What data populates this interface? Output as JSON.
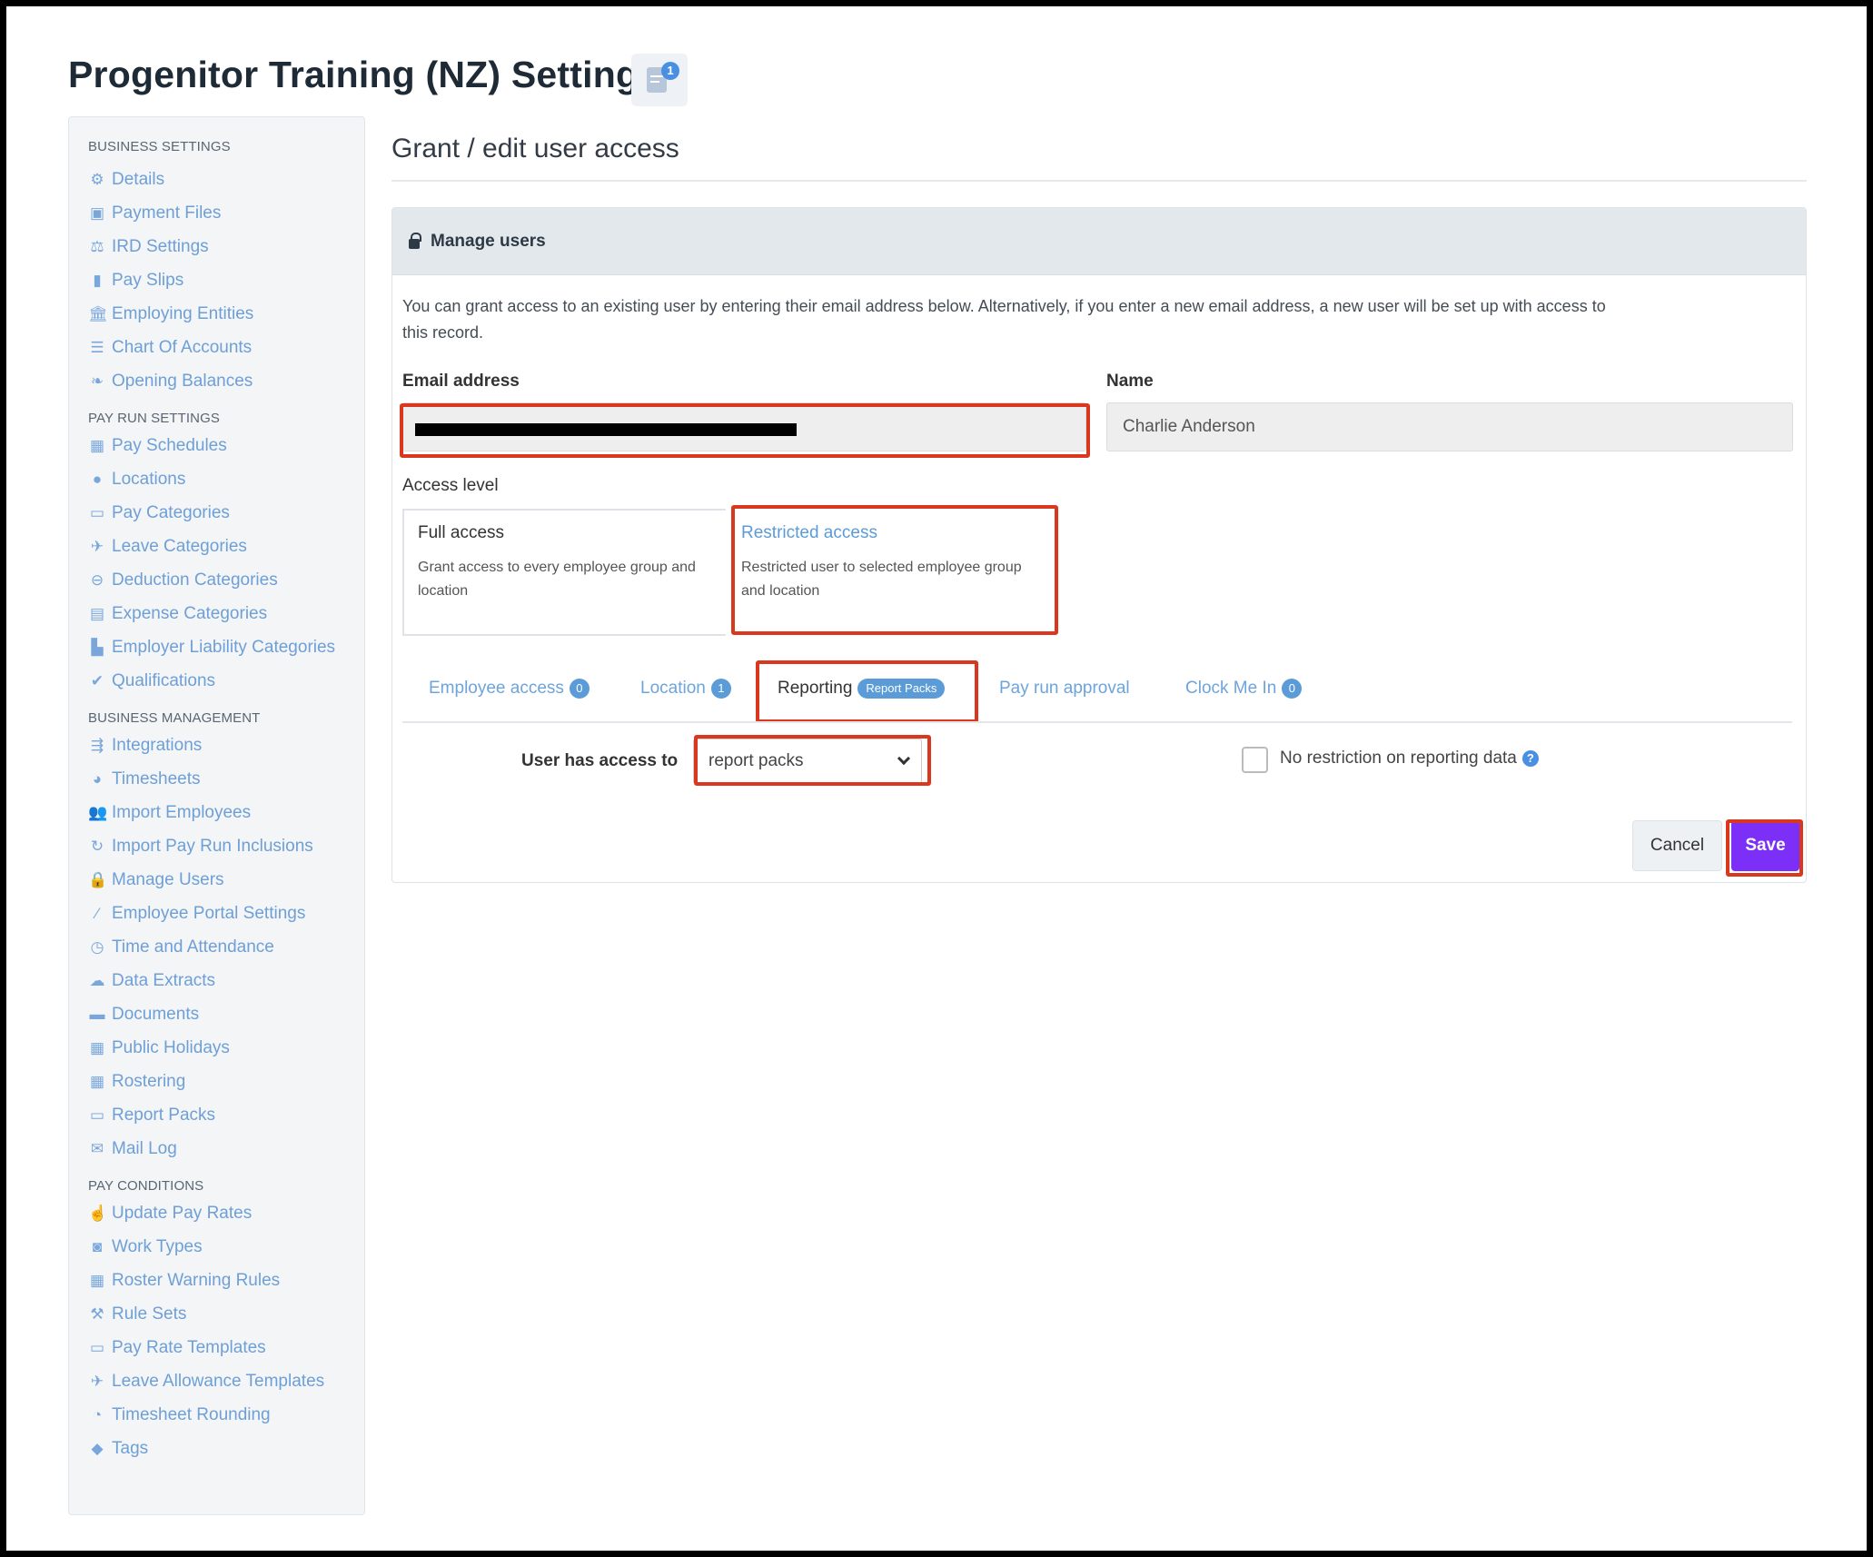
{
  "page": {
    "title": "Progenitor Training (NZ) Settings",
    "title_icon_badge": "1"
  },
  "sidebar": {
    "sections": [
      {
        "heading": "BUSINESS SETTINGS",
        "items": [
          {
            "label": "Details",
            "icon": "gear-icon",
            "glyph": "⚙"
          },
          {
            "label": "Payment Files",
            "icon": "floppy-icon",
            "glyph": "▣"
          },
          {
            "label": "IRD Settings",
            "icon": "scales-icon",
            "glyph": "⚖"
          },
          {
            "label": "Pay Slips",
            "icon": "file-icon",
            "glyph": "▮"
          },
          {
            "label": "Employing Entities",
            "icon": "institution-icon",
            "glyph": "🏛"
          },
          {
            "label": "Chart Of Accounts",
            "icon": "list-icon",
            "glyph": "☰"
          },
          {
            "label": "Opening Balances",
            "icon": "leaf-icon",
            "glyph": "❧"
          }
        ]
      },
      {
        "heading": "PAY RUN SETTINGS",
        "items": [
          {
            "label": "Pay Schedules",
            "icon": "calendar-icon",
            "glyph": "▦"
          },
          {
            "label": "Locations",
            "icon": "globe-icon",
            "glyph": "●"
          },
          {
            "label": "Pay Categories",
            "icon": "money-icon",
            "glyph": "▭"
          },
          {
            "label": "Leave Categories",
            "icon": "plane-icon",
            "glyph": "✈"
          },
          {
            "label": "Deduction Categories",
            "icon": "minus-circle-icon",
            "glyph": "⊖"
          },
          {
            "label": "Expense Categories",
            "icon": "archive-icon",
            "glyph": "▤"
          },
          {
            "label": "Employer Liability Categories",
            "icon": "bar-chart-icon",
            "glyph": "▙"
          },
          {
            "label": "Qualifications",
            "icon": "check-icon",
            "glyph": "✔"
          }
        ]
      },
      {
        "heading": "BUSINESS MANAGEMENT",
        "items": [
          {
            "label": "Integrations",
            "icon": "integrations-icon",
            "glyph": "⇶"
          },
          {
            "label": "Timesheets",
            "icon": "clock-icon",
            "glyph": "◕"
          },
          {
            "label": "Import Employees",
            "icon": "users-icon",
            "glyph": "👥"
          },
          {
            "label": "Import Pay Run Inclusions",
            "icon": "refresh-icon",
            "glyph": "↻"
          },
          {
            "label": "Manage Users",
            "icon": "lock-icon",
            "glyph": "🔒"
          },
          {
            "label": "Employee Portal Settings",
            "icon": "magic-icon",
            "glyph": "⁄"
          },
          {
            "label": "Time and Attendance",
            "icon": "stopwatch-icon",
            "glyph": "◷"
          },
          {
            "label": "Data Extracts",
            "icon": "cloud-download-icon",
            "glyph": "☁"
          },
          {
            "label": "Documents",
            "icon": "folder-icon",
            "glyph": "▬"
          },
          {
            "label": "Public Holidays",
            "icon": "calendar-icon",
            "glyph": "▦"
          },
          {
            "label": "Rostering",
            "icon": "calendar-icon",
            "glyph": "▦"
          },
          {
            "label": "Report Packs",
            "icon": "folder-open-icon",
            "glyph": "▭"
          },
          {
            "label": "Mail Log",
            "icon": "envelope-icon",
            "glyph": "✉"
          }
        ]
      },
      {
        "heading": "PAY CONDITIONS",
        "items": [
          {
            "label": "Update Pay Rates",
            "icon": "hand-money-icon",
            "glyph": "☝"
          },
          {
            "label": "Work Types",
            "icon": "camera-icon",
            "glyph": "◙"
          },
          {
            "label": "Roster Warning Rules",
            "icon": "calendar-warning-icon",
            "glyph": "▦"
          },
          {
            "label": "Rule Sets",
            "icon": "gavel-icon",
            "glyph": "⚒"
          },
          {
            "label": "Pay Rate Templates",
            "icon": "money-icon",
            "glyph": "▭"
          },
          {
            "label": "Leave Allowance Templates",
            "icon": "plane-icon",
            "glyph": "✈"
          },
          {
            "label": "Timesheet Rounding",
            "icon": "clock-icon",
            "glyph": "◔"
          },
          {
            "label": "Tags",
            "icon": "tag-icon",
            "glyph": "◆"
          }
        ]
      }
    ]
  },
  "main": {
    "title": "Grant / edit user access",
    "panel_title": "Manage users",
    "intro": "You can grant access to an existing user by entering their email address below. Alternatively, if you enter a new email address, a new user will be set up with access to this record.",
    "email_label": "Email address",
    "email_value": "",
    "name_label": "Name",
    "name_value": "Charlie Anderson",
    "access_level_label": "Access level",
    "access_options": [
      {
        "title": "Full access",
        "desc": "Grant access to every employee group and location"
      },
      {
        "title": "Restricted access",
        "desc": "Restricted user to selected employee group and location"
      }
    ],
    "tabs": [
      {
        "label": "Employee access",
        "pill": "0"
      },
      {
        "label": "Location",
        "pill": "1"
      },
      {
        "label": "Reporting",
        "pill": "Report Packs"
      },
      {
        "label": "Pay run approval",
        "pill": ""
      },
      {
        "label": "Clock Me In",
        "pill": "0"
      }
    ],
    "reporting": {
      "access_label": "User has access to",
      "select_value": "report packs",
      "no_restriction_label": "No restriction on reporting data",
      "help_glyph": "?"
    },
    "buttons": {
      "cancel": "Cancel",
      "save": "Save"
    }
  },
  "colors": {
    "link": "#6e9fd6",
    "save_button": "#7b2ff7",
    "highlight_border": "#d9381e",
    "pill": "#5b9bd8"
  }
}
